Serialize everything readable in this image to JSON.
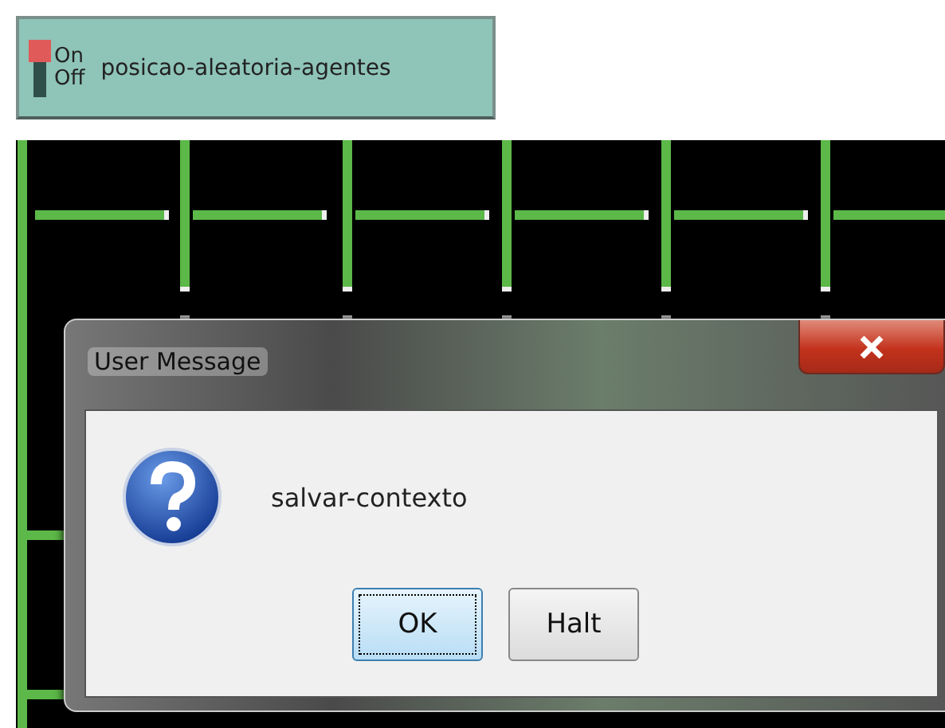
{
  "switch": {
    "on_label": "On",
    "off_label": "Off",
    "label": "posicao-aleatoria-agentes",
    "on": true
  },
  "dialog": {
    "title": "User Message",
    "message": "salvar-contexto",
    "buttons": [
      {
        "label": "OK",
        "focused": true
      },
      {
        "label": "Halt",
        "focused": false
      }
    ]
  }
}
